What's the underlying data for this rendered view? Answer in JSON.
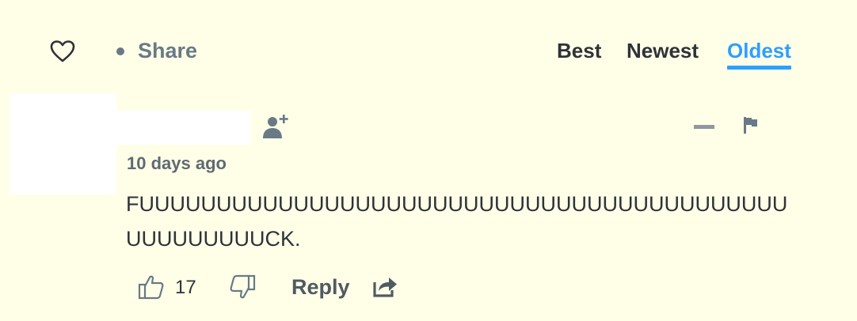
{
  "toolbar": {
    "share_label": "Share",
    "sort_tabs": [
      {
        "label": "Best",
        "active": false
      },
      {
        "label": "Newest",
        "active": false
      },
      {
        "label": "Oldest",
        "active": true
      }
    ],
    "active_color": "#2e9fff"
  },
  "comment": {
    "timestamp": "10 days ago",
    "body_lines": [
      "FUUUUUUUUUUUUUUUUUUUUUUUUUUUUUUUUUUUUUUUUUU",
      "UUUUUUUUUCK."
    ],
    "upvotes": "17",
    "reply_label": "Reply"
  },
  "icons": {
    "heart": "heart-icon",
    "follow": "add-user-icon",
    "collapse": "minus-icon",
    "flag": "flag-icon",
    "upvote": "thumbs-up-icon",
    "downvote": "thumbs-down-icon",
    "share": "share-icon"
  },
  "colors": {
    "background": "#ffffe8",
    "muted": "#687a86",
    "text": "#2e3338"
  }
}
